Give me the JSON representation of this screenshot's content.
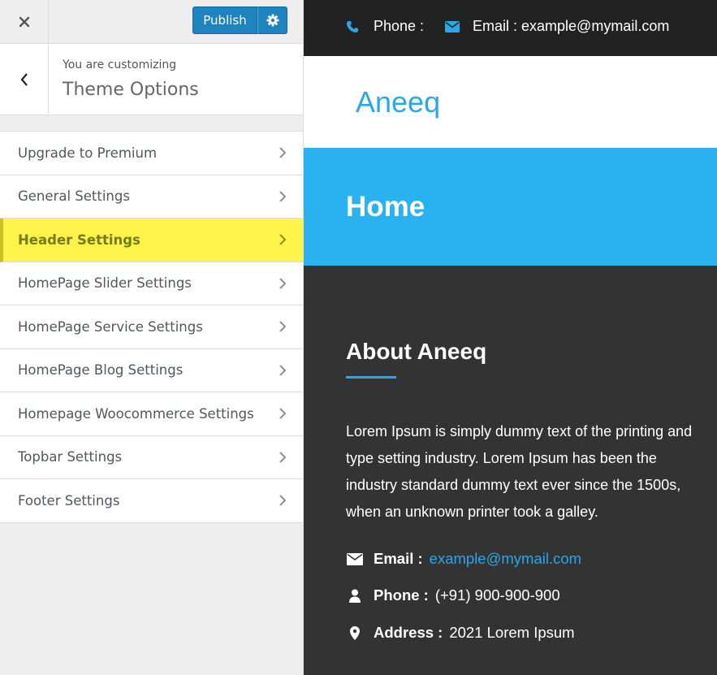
{
  "customizer": {
    "publish_label": "Publish",
    "customizing_label": "You are customizing",
    "section_title": "Theme Options",
    "menu": [
      {
        "label": "Upgrade to Premium",
        "highlighted": false
      },
      {
        "label": "General Settings",
        "highlighted": false
      },
      {
        "label": "Header Settings",
        "highlighted": true
      },
      {
        "label": "HomePage Slider Settings",
        "highlighted": false
      },
      {
        "label": "HomePage Service Settings",
        "highlighted": false
      },
      {
        "label": "HomePage Blog Settings",
        "highlighted": false
      },
      {
        "label": "Homepage Woocommerce Settings",
        "highlighted": false
      },
      {
        "label": "Topbar Settings",
        "highlighted": false
      },
      {
        "label": "Footer Settings",
        "highlighted": false
      }
    ],
    "icons": {
      "close": "close-icon",
      "settings": "gear-icon",
      "back": "chevron-left-icon",
      "item": "chevron-right-icon"
    }
  },
  "preview": {
    "topbar": {
      "phone_label": "Phone :",
      "email_label": "Email : example@mymail.com"
    },
    "site_title": "Aneeq",
    "banner_title": "Home",
    "about": {
      "title": "About Aneeq",
      "text": "Lorem Ipsum is simply dummy text of the printing and type setting industry. Lorem Ipsum has been the industry standard dummy text ever since the 1500s, when an unknown printer took a galley.",
      "email_label": "Email :",
      "email_value": "example@mymail.com",
      "phone_label": "Phone :",
      "phone_value": "(+91) 900-900-900",
      "address_label": "Address :",
      "address_value": "2021 Lorem Ipsum"
    }
  },
  "colors": {
    "accent": "#2aa7e8",
    "publish": "#1e84c0",
    "highlight": "#fdf34b",
    "banner": "#2ab1f0",
    "dark": "#333333"
  }
}
